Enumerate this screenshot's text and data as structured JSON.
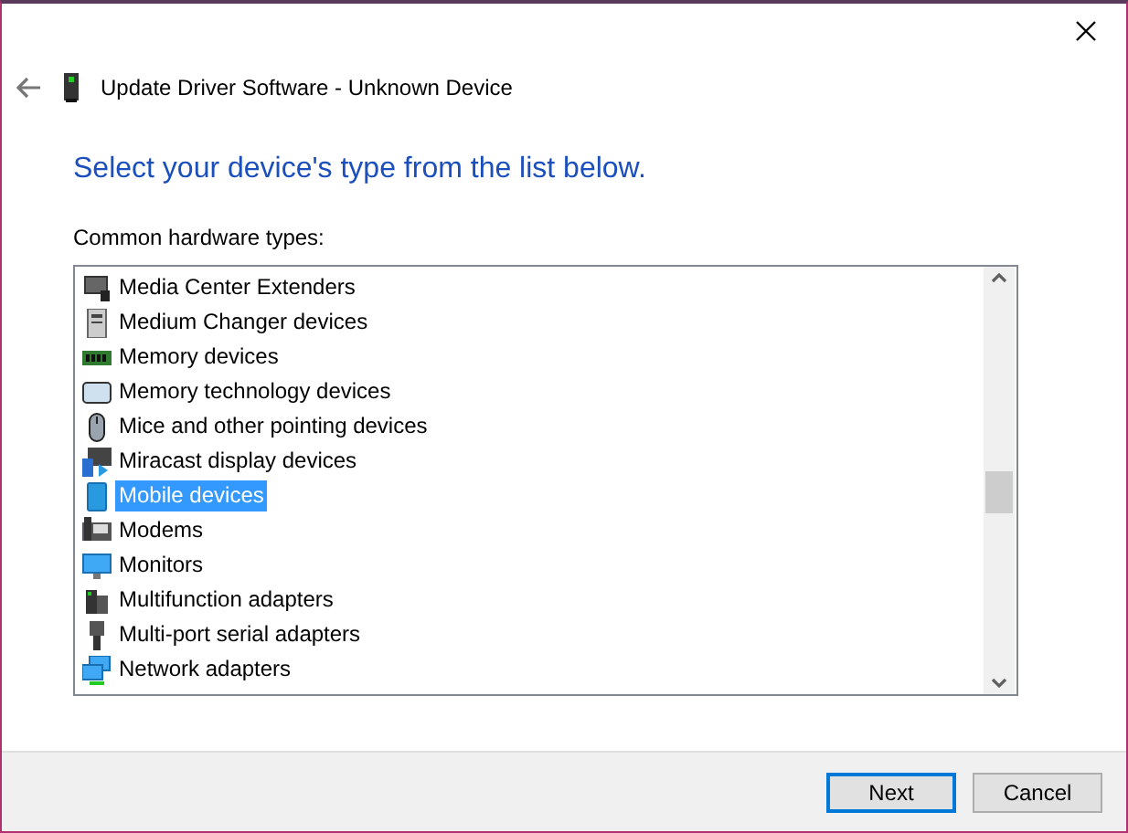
{
  "window": {
    "title": "Update Driver Software - Unknown Device"
  },
  "heading": "Select your device's type from the list below.",
  "list_label": "Common hardware types:",
  "items": [
    {
      "label": "Media Center Extenders",
      "kind": "extender",
      "selected": false
    },
    {
      "label": "Medium Changer devices",
      "kind": "changer",
      "selected": false
    },
    {
      "label": "Memory devices",
      "kind": "memory",
      "selected": false
    },
    {
      "label": "Memory technology devices",
      "kind": "card",
      "selected": false
    },
    {
      "label": "Mice and other pointing devices",
      "kind": "mouse",
      "selected": false
    },
    {
      "label": "Miracast display devices",
      "kind": "miracast",
      "selected": false
    },
    {
      "label": "Mobile devices",
      "kind": "mobile",
      "selected": true
    },
    {
      "label": "Modems",
      "kind": "modem",
      "selected": false
    },
    {
      "label": "Monitors",
      "kind": "monitor",
      "selected": false
    },
    {
      "label": "Multifunction adapters",
      "kind": "multifunction",
      "selected": false
    },
    {
      "label": "Multi-port serial adapters",
      "kind": "serial",
      "selected": false
    },
    {
      "label": "Network adapters",
      "kind": "network",
      "selected": false
    }
  ],
  "buttons": [
    {
      "label": "Next",
      "kind": "default"
    },
    {
      "label": "Cancel",
      "kind": "normal"
    }
  ]
}
